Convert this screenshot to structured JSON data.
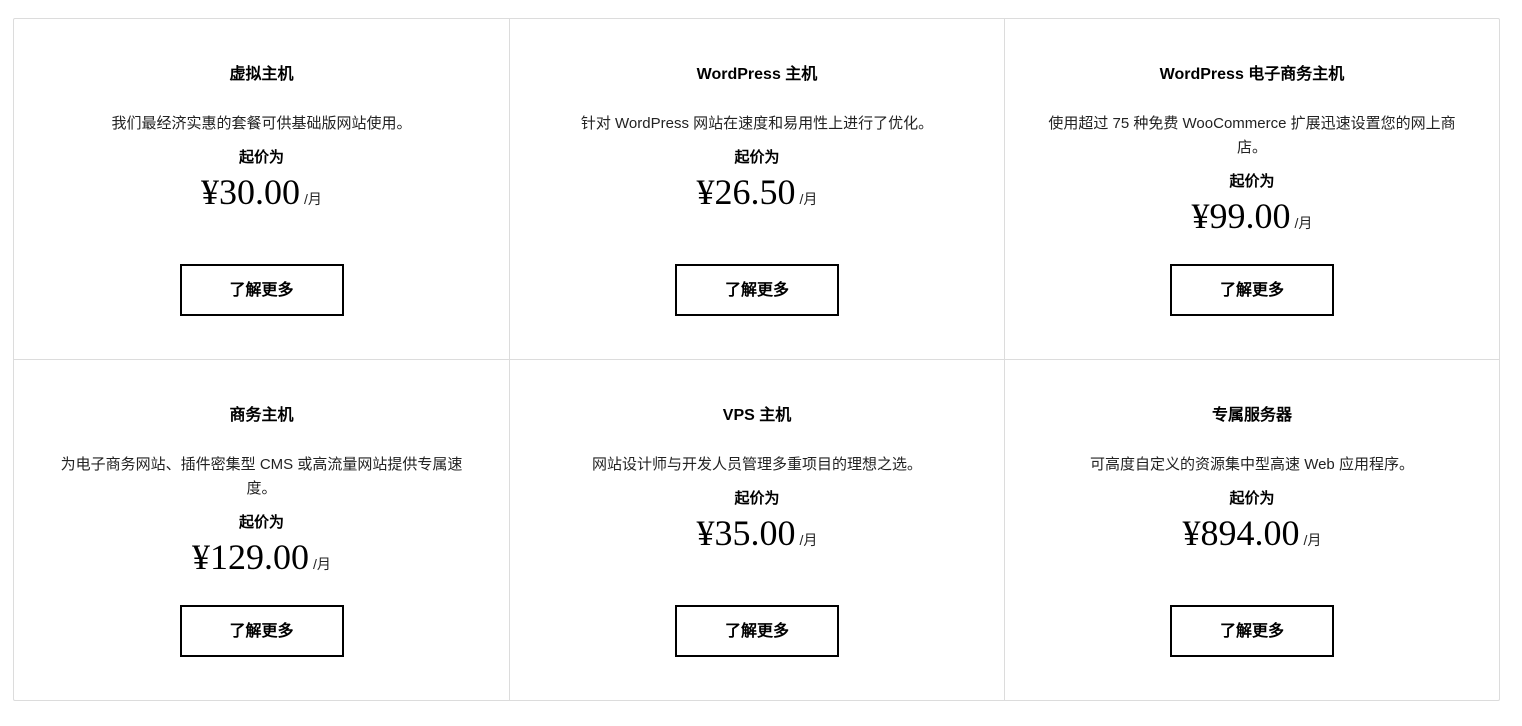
{
  "plans": [
    {
      "title": "虚拟主机",
      "description": "我们最经济实惠的套餐可供基础版网站使用。",
      "from_label": "起价为",
      "price": "¥30.00",
      "per": "/月",
      "button_label": "了解更多"
    },
    {
      "title": "WordPress 主机",
      "description": "针对 WordPress 网站在速度和易用性上进行了优化。",
      "from_label": "起价为",
      "price": "¥26.50",
      "per": "/月",
      "button_label": "了解更多"
    },
    {
      "title": "WordPress 电子商务主机",
      "description": "使用超过 75 种免费 WooCommerce 扩展迅速设置您的网上商店。",
      "from_label": "起价为",
      "price": "¥99.00",
      "per": "/月",
      "button_label": "了解更多"
    },
    {
      "title": "商务主机",
      "description": "为电子商务网站、插件密集型 CMS 或高流量网站提供专属速度。",
      "from_label": "起价为",
      "price": "¥129.00",
      "per": "/月",
      "button_label": "了解更多"
    },
    {
      "title": "VPS 主机",
      "description": "网站设计师与开发人员管理多重项目的理想之选。",
      "from_label": "起价为",
      "price": "¥35.00",
      "per": "/月",
      "button_label": "了解更多"
    },
    {
      "title": "专属服务器",
      "description": "可高度自定义的资源集中型高速 Web 应用程序。",
      "from_label": "起价为",
      "price": "¥894.00",
      "per": "/月",
      "button_label": "了解更多"
    }
  ]
}
